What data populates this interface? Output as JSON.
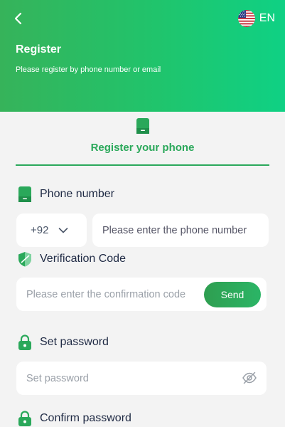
{
  "header": {
    "title": "Register",
    "subtitle": "Please register by phone number or email",
    "language": "EN",
    "back_icon": "chevron-left-icon",
    "flag_icon": "us-flag-icon"
  },
  "tabs": [
    {
      "label": "Register your phone",
      "icon": "phone-icon",
      "active": true
    }
  ],
  "form": {
    "phone": {
      "label": "Phone number",
      "country_code": "+92",
      "placeholder": "Please enter the phone number"
    },
    "verification": {
      "label": "Verification Code",
      "placeholder": "Please enter the confirmation code",
      "send_label": "Send"
    },
    "password": {
      "label": "Set password",
      "placeholder": "Set password"
    },
    "confirm_password": {
      "label": "Confirm password"
    }
  },
  "colors": {
    "accent": "#2aa85a",
    "header_start": "#36b35a",
    "header_end": "#0fd184",
    "background": "#f3f3f3"
  }
}
